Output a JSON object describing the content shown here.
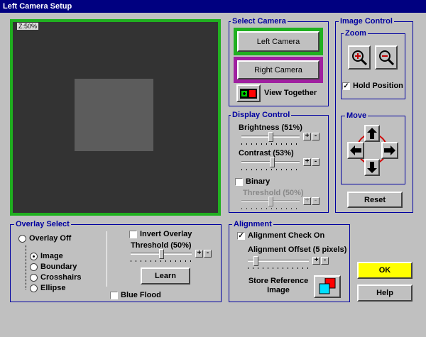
{
  "window": {
    "title": "Left Camera Setup"
  },
  "preview": {
    "zoom_badge": "Z:50%"
  },
  "select_camera": {
    "title": "Select Camera",
    "left_camera": "Left Camera",
    "right_camera": "Right Camera",
    "view_together": "View Together"
  },
  "image_control": {
    "title": "Image Control",
    "zoom_title": "Zoom",
    "hold_position": "Hold Position",
    "hold_position_checked": true,
    "move_title": "Move",
    "reset": "Reset"
  },
  "display_control": {
    "title": "Display Control",
    "brightness": "Brightness (51%)",
    "brightness_value": 51,
    "contrast": "Contrast (53%)",
    "contrast_value": 53,
    "binary": "Binary",
    "binary_checked": false,
    "threshold": "Threshold (50%)",
    "threshold_value": 50
  },
  "overlay_select": {
    "title": "Overlay Select",
    "overlay_off": "Overlay Off",
    "options": [
      "Image",
      "Boundary",
      "Crosshairs",
      "Ellipse"
    ],
    "selected": "Image",
    "invert_overlay": "Invert Overlay",
    "threshold": "Threshold (50%)",
    "threshold_value": 50,
    "learn": "Learn",
    "blue_flood": "Blue Flood"
  },
  "alignment": {
    "title": "Alignment",
    "check_on": "Alignment Check On",
    "check_on_checked": true,
    "offset": "Alignment Offset (5 pixels)",
    "offset_value": 5,
    "store_reference": "Store Reference Image"
  },
  "actions": {
    "ok": "OK",
    "help": "Help"
  },
  "slider_buttons": {
    "plus": "+",
    "minus": "-"
  },
  "colors": {
    "accent_blue": "#0000a0",
    "title_bar": "#000080",
    "left_camera_highlight": "#20b020",
    "right_camera_highlight": "#a020a0",
    "ok_button": "#ffff00"
  }
}
